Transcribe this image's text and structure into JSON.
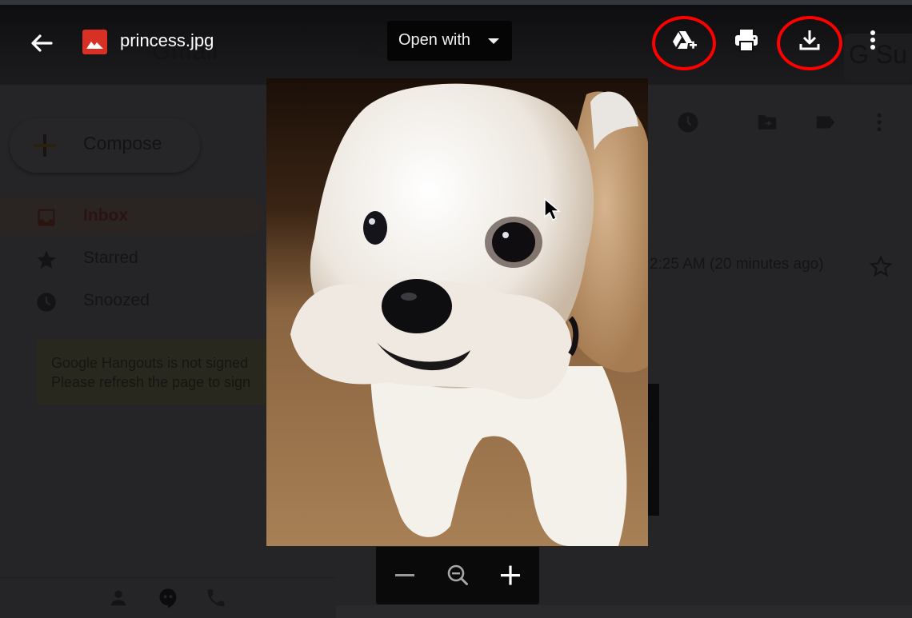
{
  "viewer": {
    "file_name": "princess.jpg",
    "file_type_icon": "image-file-icon",
    "open_with_label": "Open with",
    "actions": [
      {
        "name": "add-to-drive",
        "icon": "drive-add-icon",
        "highlighted": true
      },
      {
        "name": "print",
        "icon": "print-icon",
        "highlighted": false
      },
      {
        "name": "download",
        "icon": "download-icon",
        "highlighted": true
      },
      {
        "name": "more-options",
        "icon": "more-vert-icon",
        "highlighted": false
      }
    ],
    "highlight_color": "#ff0000",
    "zoom_controls": {
      "zoom_out_icon": "minus-icon",
      "reset_icon": "zoom-reset-icon",
      "zoom_in_icon": "plus-icon"
    },
    "image_subject": "white and tan small dog on carpet"
  },
  "background_app": {
    "logo_text": "Gmail",
    "gsuite_text": "G Su",
    "compose_label": "Compose",
    "nav": [
      {
        "label": "Inbox",
        "icon": "inbox-icon",
        "active": true
      },
      {
        "label": "Starred",
        "icon": "star-icon",
        "active": false
      },
      {
        "label": "Snoozed",
        "icon": "clock-icon",
        "active": false
      }
    ],
    "hangouts_notice": {
      "line1": "Google Hangouts is not signed",
      "line2": "Please refresh the page to sign"
    },
    "email_timestamp": "2:25 AM (20 minutes ago)",
    "toolbar_icons": [
      "snooze-icon",
      "move-to-icon",
      "label-icon",
      "more-vert-icon"
    ],
    "bottom_icons": [
      "contacts-icon",
      "hangouts-icon",
      "phone-icon"
    ]
  },
  "colors": {
    "overlay_bg": "#252427",
    "bar_bg": "#0e0e10",
    "file_icon_red": "#d93025",
    "accent_ring": "#ff0000"
  }
}
